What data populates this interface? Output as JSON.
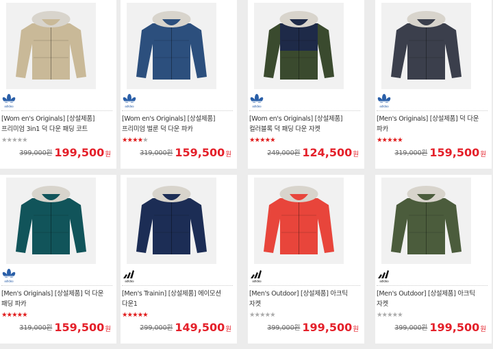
{
  "products": [
    {
      "brand": "adidas originals",
      "brand_icon": "adidas-trefoil-icon",
      "title": "[Wom en's Originals] [상설제품] 프리미엄 3in1 덕 다운 패딩 코트",
      "rating": 0,
      "original_price": "399,000원",
      "sale_price": "199,500",
      "currency": "원",
      "color": "#c9b998"
    },
    {
      "brand": "adidas originals",
      "brand_icon": "adidas-trefoil-icon",
      "title": "[Wom en's Originals] [상설제품] 프리미엄 벌룬 덕 다운 파카",
      "rating": 4,
      "original_price": "319,000원",
      "sale_price": "159,500",
      "currency": "원",
      "color": "#2c4f7d"
    },
    {
      "brand": "adidas originals",
      "brand_icon": "adidas-trefoil-icon",
      "title": "[Wom en's Originals] [상설제품] 컬러블록 덕 패딩 다운 자켓",
      "rating": 5,
      "original_price": "249,000원",
      "sale_price": "124,500",
      "currency": "원",
      "color": "#1e2a48",
      "color2": "#3a4a2e"
    },
    {
      "brand": "adidas originals",
      "brand_icon": "adidas-trefoil-icon",
      "title": "[Men's Originals] [상설제품] 덕 다운 파카",
      "rating": 5,
      "original_price": "319,000원",
      "sale_price": "159,500",
      "currency": "원",
      "color": "#3b3f4c"
    },
    {
      "brand": "adidas originals",
      "brand_icon": "adidas-trefoil-icon",
      "title": "[Men's Originals] [상설제품] 덕 다운 패딩 파카",
      "rating": 5,
      "original_price": "319,000원",
      "sale_price": "159,500",
      "currency": "원",
      "color": "#11545a"
    },
    {
      "brand": "adidas performance",
      "brand_icon": "adidas-performance-icon",
      "title": "[Men's Trainin] [상설제품] 에이모션 다운1",
      "rating": 5,
      "original_price": "299,000원",
      "sale_price": "149,500",
      "currency": "원",
      "color": "#1c2d55"
    },
    {
      "brand": "adidas performance",
      "brand_icon": "adidas-performance-icon",
      "title": "[Men's Outdoor] [상설제품] 아크틱 자켓",
      "rating": 0,
      "original_price": "399,000원",
      "sale_price": "199,500",
      "currency": "원",
      "color": "#e8453b"
    },
    {
      "brand": "adidas performance",
      "brand_icon": "adidas-performance-icon",
      "title": "[Men's Outdoor] [상설제품] 아크틱 자켓",
      "rating": 0,
      "original_price": "399,000원",
      "sale_price": "199,500",
      "currency": "원",
      "color": "#4b5c3c"
    }
  ]
}
